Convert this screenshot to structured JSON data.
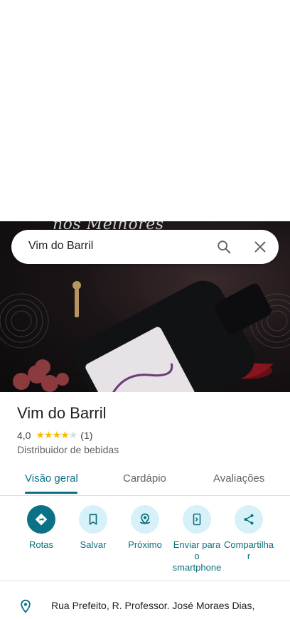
{
  "photo": {
    "caption": "nos Melhores"
  },
  "search": {
    "query": "Vim do Barril"
  },
  "place": {
    "name": "Vim do Barril",
    "rating": "4,0",
    "rating_value": 4,
    "reviews": "(1)",
    "category": "Distribuidor de bebidas"
  },
  "tabs": [
    {
      "label": "Visão geral",
      "active": true
    },
    {
      "label": "Cardápio",
      "active": false
    },
    {
      "label": "Avaliações",
      "active": false
    }
  ],
  "actions": [
    {
      "label": "Rotas",
      "icon": "directions-icon"
    },
    {
      "label": "Salvar",
      "icon": "bookmark-icon"
    },
    {
      "label": "Próximo",
      "icon": "nearby-icon"
    },
    {
      "label_line1": "Enviar para",
      "label_line2": "o",
      "label_line3": "smartphone",
      "icon": "send-to-phone-icon"
    },
    {
      "label_line1": "Compartilha",
      "label_line2": "r",
      "icon": "share-icon"
    }
  ],
  "address": {
    "text": "Rua Prefeito, R. Professor. José Moraes Dias,"
  },
  "colors": {
    "accent": "#0b7285",
    "action_bg": "#d6f1f7",
    "star": "#fbbc04"
  }
}
